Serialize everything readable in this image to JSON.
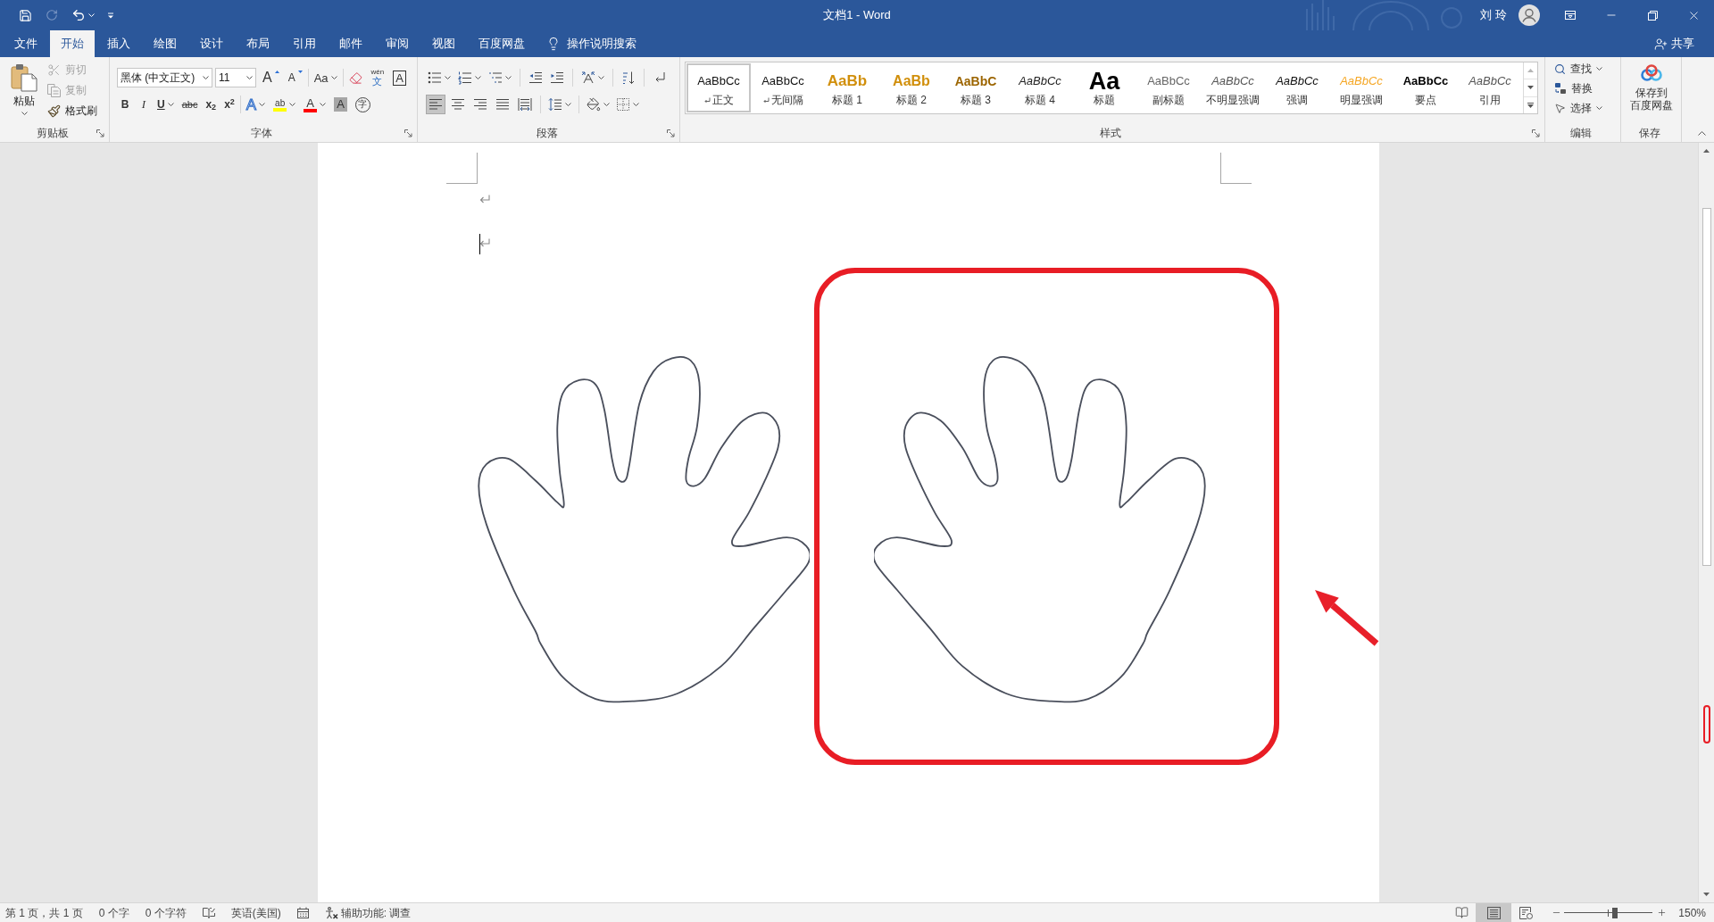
{
  "title_bar": {
    "title": "文档1 - Word",
    "user": "刘 玲"
  },
  "quick_access": [
    {
      "kind": "save",
      "disabled": false
    },
    {
      "kind": "redo",
      "disabled": true
    },
    {
      "kind": "undo",
      "disabled": false
    },
    {
      "kind": "customize",
      "disabled": false
    }
  ],
  "tabs": [
    {
      "label": "文件",
      "selected": false
    },
    {
      "label": "开始",
      "selected": true
    },
    {
      "label": "插入",
      "selected": false
    },
    {
      "label": "绘图",
      "selected": false
    },
    {
      "label": "设计",
      "selected": false
    },
    {
      "label": "布局",
      "selected": false
    },
    {
      "label": "引用",
      "selected": false
    },
    {
      "label": "邮件",
      "selected": false
    },
    {
      "label": "审阅",
      "selected": false
    },
    {
      "label": "视图",
      "selected": false
    },
    {
      "label": "百度网盘",
      "selected": false
    }
  ],
  "tell_me": "操作说明搜索",
  "share": "共享",
  "clipboard": {
    "paste": "粘贴",
    "items": [
      {
        "kind": "cut",
        "label": "剪切",
        "disabled": true
      },
      {
        "kind": "copy",
        "label": "复制",
        "disabled": true
      },
      {
        "kind": "format_painter",
        "label": "格式刷",
        "disabled": false
      }
    ],
    "label": "剪贴板"
  },
  "font": {
    "font_name": "黑体 (中文正文)",
    "font_size": "11",
    "row_1": [
      {
        "kind": "grow",
        "label": "A"
      },
      {
        "kind": "shrink",
        "label": "A"
      },
      {
        "kind": "case",
        "label": "Aa"
      },
      {
        "kind": "clear"
      },
      {
        "kind": "phonetic",
        "top": "wén",
        "label": "文"
      },
      {
        "kind": "border",
        "label": "A"
      }
    ],
    "row_2": [
      {
        "kind": "bold",
        "label": "B"
      },
      {
        "kind": "italic",
        "label": "I"
      },
      {
        "kind": "underline",
        "label": "U"
      },
      {
        "kind": "strike",
        "label": "abc"
      },
      {
        "kind": "subscript",
        "label": "x$_{2}$"
      },
      {
        "kind": "superscript",
        "label": "x$^{2}$"
      },
      {
        "kind": "effects",
        "label": "A"
      },
      {
        "kind": "highlight",
        "label": "ab"
      },
      {
        "kind": "color",
        "label": "A"
      },
      {
        "kind": "shading",
        "label": "A"
      },
      {
        "kind": "enclosed",
        "label": "字"
      }
    ],
    "label": "字体"
  },
  "paragraph": {
    "alignment": [
      {
        "kind": "left",
        "selected": true
      },
      {
        "kind": "center",
        "selected": false
      },
      {
        "kind": "right",
        "selected": false
      },
      {
        "kind": "justify",
        "selected": false
      },
      {
        "kind": "distributed",
        "selected": false
      }
    ],
    "label": "段落"
  },
  "styles": {
    "items": [
      {
        "preview": "AaBbCc",
        "name": "正文",
        "kind": "normal",
        "paragraph_mark": true,
        "selected": true
      },
      {
        "preview": "AaBbCc",
        "name": "无间隔",
        "kind": "no_spacing",
        "paragraph_mark": true,
        "selected": false
      },
      {
        "preview": "AaBb",
        "name": "标题 1",
        "kind": "heading1",
        "paragraph_mark": false,
        "selected": false
      },
      {
        "preview": "AaBb",
        "name": "标题 2",
        "kind": "heading2",
        "paragraph_mark": false,
        "selected": false
      },
      {
        "preview": "AaBbC",
        "name": "标题 3",
        "kind": "heading3",
        "paragraph_mark": false,
        "selected": false
      },
      {
        "preview": "AaBbCc",
        "name": "标题 4",
        "kind": "heading4",
        "paragraph_mark": false,
        "selected": false
      },
      {
        "preview": "Aa",
        "name": "标题",
        "kind": "title",
        "paragraph_mark": false,
        "selected": false
      },
      {
        "preview": "AaBbCc",
        "name": "副标题",
        "kind": "subtitle",
        "paragraph_mark": false,
        "selected": false
      },
      {
        "preview": "AaBbCc",
        "name": "不明显强调",
        "kind": "subtle_emphasis",
        "paragraph_mark": false,
        "selected": false
      },
      {
        "preview": "AaBbCc",
        "name": "强调",
        "kind": "emphasis",
        "paragraph_mark": false,
        "selected": false
      },
      {
        "preview": "AaBbCc",
        "name": "明显强调",
        "kind": "intense_emphasis",
        "paragraph_mark": false,
        "selected": false
      },
      {
        "preview": "AaBbCc",
        "name": "要点",
        "kind": "strong",
        "paragraph_mark": false,
        "selected": false
      },
      {
        "preview": "AaBbCc",
        "name": "引用",
        "kind": "quote",
        "paragraph_mark": false,
        "selected": false
      }
    ],
    "label": "样式"
  },
  "editing": {
    "items": [
      {
        "kind": "find",
        "label": "查找"
      },
      {
        "kind": "replace",
        "label": "替换"
      },
      {
        "kind": "select",
        "label": "选择"
      }
    ],
    "label": "编辑"
  },
  "save_group": {
    "button": [
      "保存到",
      "百度网盘"
    ],
    "label": "保存"
  },
  "status_bar": {
    "items": [
      {
        "kind": "page",
        "label": "第 1 页，共 1 页"
      },
      {
        "kind": "words",
        "label": "0 个字"
      },
      {
        "kind": "characters",
        "label": "0 个字符"
      },
      {
        "kind": "proofing"
      },
      {
        "kind": "language",
        "label": "英语(美国)"
      },
      {
        "kind": "macro"
      },
      {
        "kind": "accessibility",
        "label": "辅助功能: 调查"
      }
    ],
    "views": [
      {
        "kind": "read",
        "selected": false
      },
      {
        "kind": "print",
        "selected": true
      },
      {
        "kind": "web",
        "selected": false
      }
    ],
    "zoom": {
      "level": 0.57,
      "reading": "150%"
    }
  }
}
